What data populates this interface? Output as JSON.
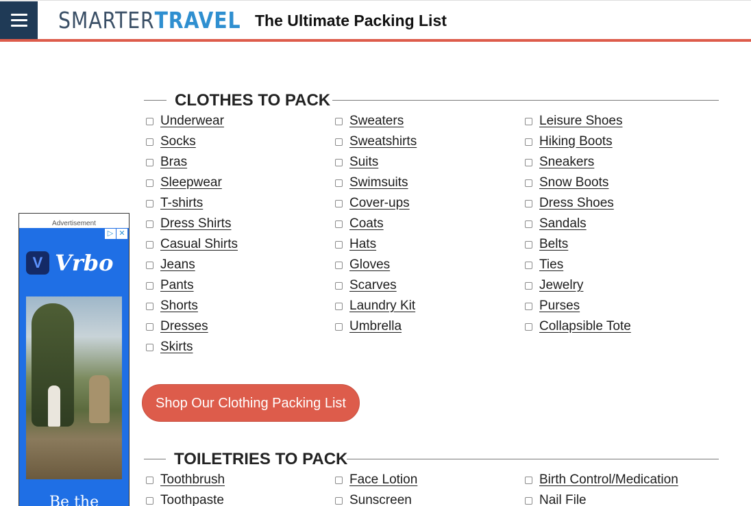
{
  "header": {
    "logo_part1": "SMARTER",
    "logo_part2": "TRAVEL",
    "title": "The Ultimate Packing List",
    "menu_icon": "hamburger-menu-icon",
    "accent_color": "#dd5c4b",
    "menu_bg_color": "#1f3a56"
  },
  "ad": {
    "label": "Advertisement",
    "brand": "Vrbo",
    "brand_mark": "V",
    "cta_partial": "Be the",
    "background_color": "#1f6fe5"
  },
  "clothes": {
    "title": "CLOTHES TO PACK",
    "columns": [
      [
        "Underwear",
        "Socks",
        "Bras",
        "Sleepwear",
        "T-shirts",
        "Dress Shirts",
        "Casual Shirts",
        "Jeans",
        "Pants",
        "Shorts",
        "Dresses",
        "Skirts"
      ],
      [
        "Sweaters",
        "Sweatshirts",
        "Suits",
        "Swimsuits",
        "Cover-ups",
        "Coats",
        "Hats",
        "Gloves",
        "Scarves",
        "Laundry Kit",
        "Umbrella"
      ],
      [
        "Leisure Shoes",
        "Hiking Boots",
        "Sneakers",
        "Snow Boots",
        "Dress Shoes",
        "Sandals",
        "Belts",
        "Ties",
        "Jewelry",
        "Purses",
        "Collapsible Tote"
      ]
    ],
    "shop_button": "Shop Our Clothing Packing List"
  },
  "toiletries": {
    "title": "TOILETRIES TO PACK",
    "columns": [
      [
        "Toothbrush",
        "Toothpaste"
      ],
      [
        "Face Lotion",
        "Sunscreen"
      ],
      [
        "Birth Control/Medication",
        "Nail File"
      ]
    ]
  }
}
